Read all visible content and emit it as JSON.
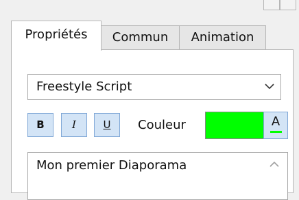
{
  "tabs": [
    {
      "label": "Propriétés"
    },
    {
      "label": "Commun"
    },
    {
      "label": "Animation"
    }
  ],
  "font_select": {
    "value": "Freestyle Script",
    "icon": "chevron-down-icon"
  },
  "format_buttons": {
    "bold_label": "B",
    "italic_label": "I",
    "underline_label": "U"
  },
  "color": {
    "label": "Couleur",
    "swatch_color": "#00ff00",
    "font_color_button_label": "A",
    "font_color_bar": "#00ff00"
  },
  "text": {
    "value": "Mon premier Diaporama",
    "scroll_icon": "chevron-up-icon"
  },
  "colors": {
    "accent_button_bg": "#d3e4f6",
    "accent_button_border": "#7fa7d6"
  }
}
